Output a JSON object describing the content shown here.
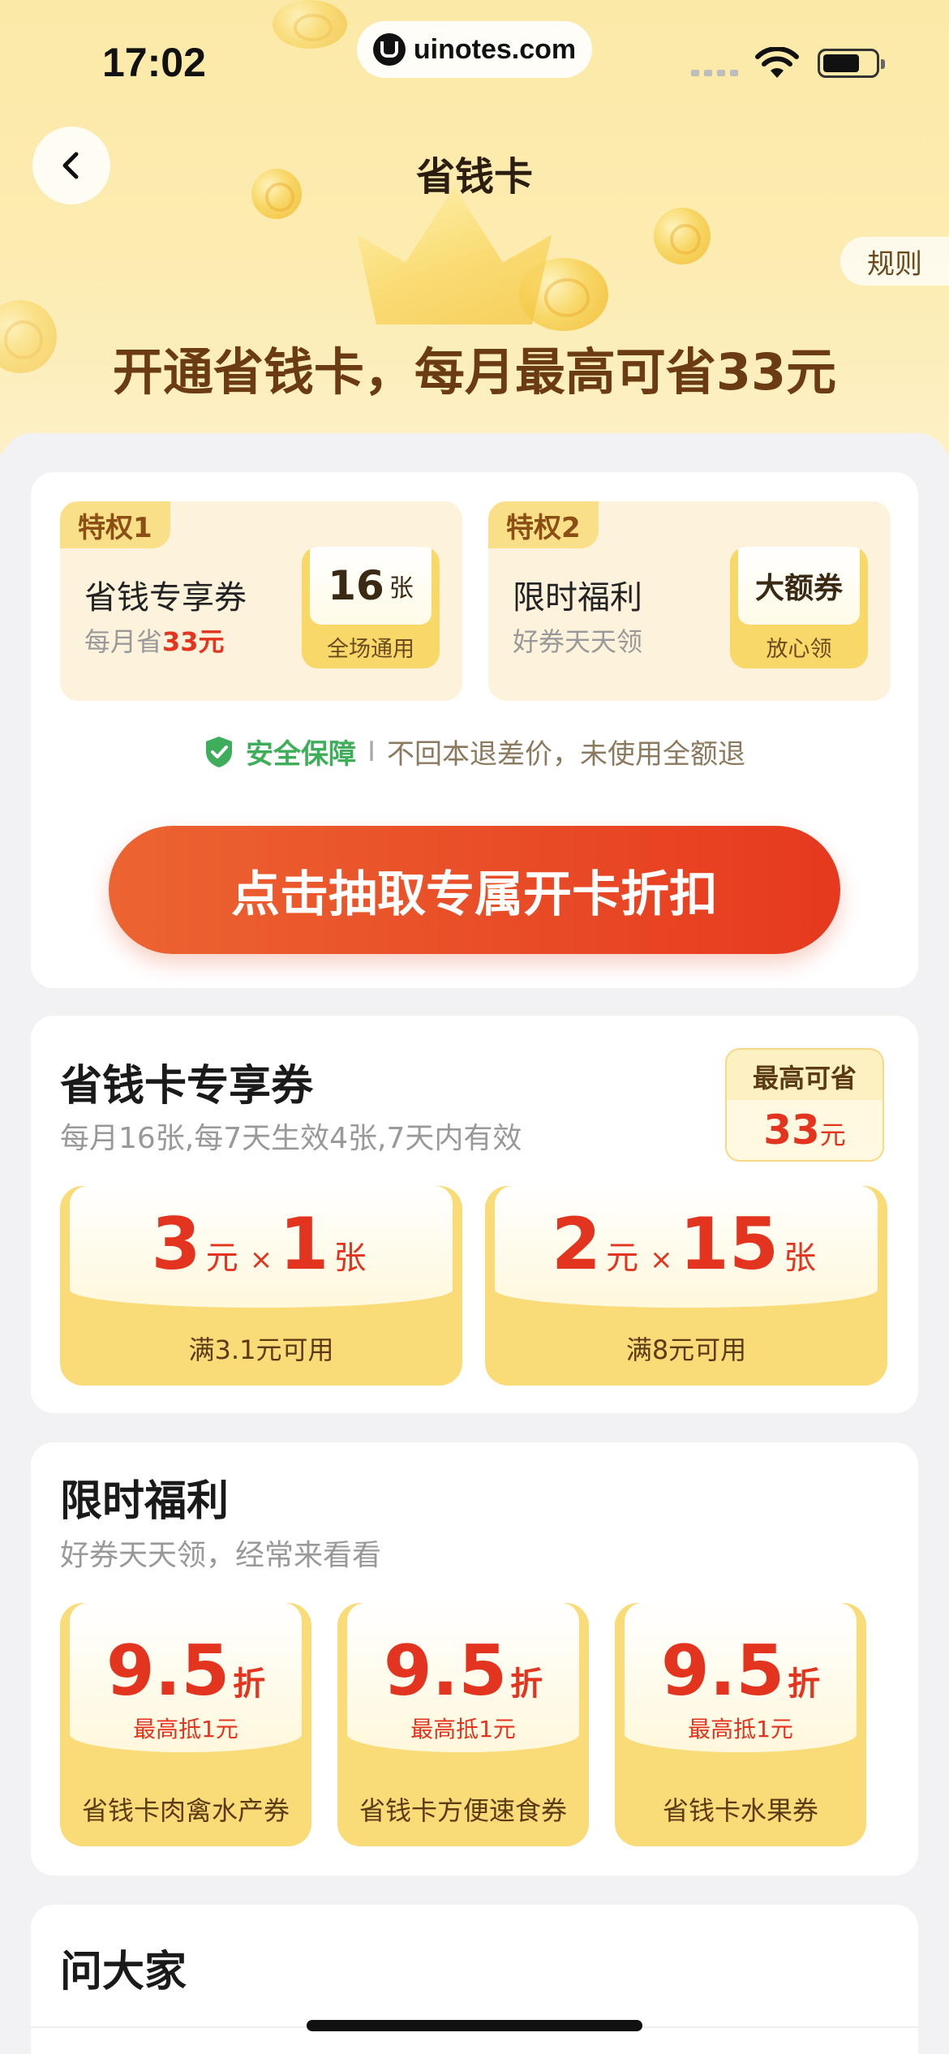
{
  "status_bar": {
    "time": "17:02",
    "url": "uinotes.com"
  },
  "header": {
    "title": "省钱卡",
    "rules_label": "规则",
    "headline": "开通省钱卡，每月最高可省33元"
  },
  "privileges": [
    {
      "tag": "特权1",
      "title": "省钱专享券",
      "sub_prefix": "每月省",
      "sub_value": "33元",
      "box_big": "16",
      "box_unit": "张",
      "box_bottom": "全场通用"
    },
    {
      "tag": "特权2",
      "title": "限时福利",
      "sub_prefix": "好券天天领",
      "box_big": "大额券",
      "box_bottom": "放心领"
    }
  ],
  "safety": {
    "label": "安全保障",
    "separator": "I",
    "text": "不回本退差价，未使用全额退"
  },
  "cta_label": "点击抽取专属开卡折扣",
  "exclusive_coupons": {
    "title": "省钱卡专享券",
    "subtitle": "每月16张,每7天生效4张,7天内有效",
    "max_save_label": "最高可省",
    "max_save_value": "33",
    "max_save_unit": "元",
    "coupons": [
      {
        "amount": "3",
        "amount_unit": "元",
        "times": "×",
        "count": "1",
        "count_unit": "张",
        "condition": "满3.1元可用"
      },
      {
        "amount": "2",
        "amount_unit": "元",
        "times": "×",
        "count": "15",
        "count_unit": "张",
        "condition": "满8元可用"
      }
    ]
  },
  "limited_benefits": {
    "title": "限时福利",
    "subtitle": "好券天天领，经常来看看",
    "coupons": [
      {
        "discount": "9.5",
        "unit": "折",
        "cap": "最高抵1元",
        "name": "省钱卡肉禽水产券"
      },
      {
        "discount": "9.5",
        "unit": "折",
        "cap": "最高抵1元",
        "name": "省钱卡方便速食券"
      },
      {
        "discount": "9.5",
        "unit": "折",
        "cap": "最高抵1元",
        "name": "省钱卡水果券"
      }
    ]
  },
  "ask_section": {
    "title": "问大家"
  },
  "icons": {
    "back": "chevron-left-icon",
    "safety": "shield-check-icon",
    "wifi": "wifi-icon",
    "battery": "battery-icon"
  },
  "colors": {
    "accent_red": "#e3341f",
    "cta_gradient_start": "#ec6431",
    "cta_gradient_end": "#e6391f",
    "gold": "#f9db78",
    "safety_green": "#3fae5a"
  }
}
